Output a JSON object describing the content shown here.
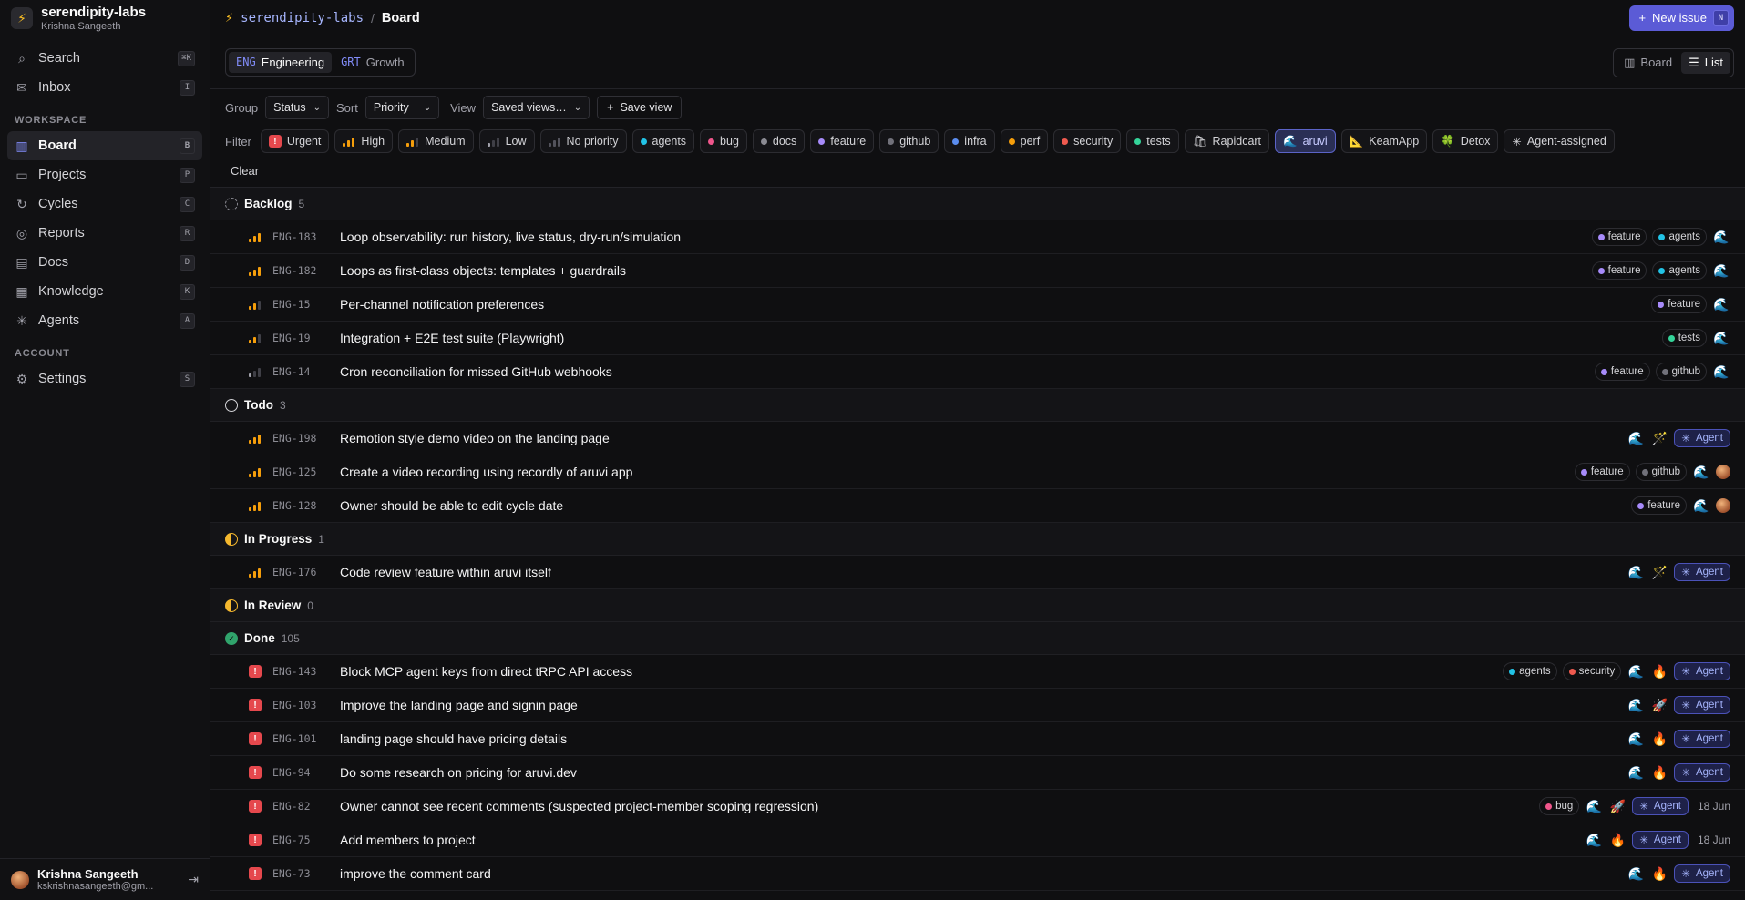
{
  "org": {
    "name": "serendipity-labs",
    "user": "Krishna Sangeeth"
  },
  "nav_top": [
    {
      "label": "Search",
      "key": "⌘K",
      "icon": "⌕"
    },
    {
      "label": "Inbox",
      "key": "I",
      "icon": "✉"
    }
  ],
  "workspace_heading": "WORKSPACE",
  "nav_workspace": [
    {
      "label": "Board",
      "key": "B",
      "icon": "▥",
      "active": true
    },
    {
      "label": "Projects",
      "key": "P",
      "icon": "▭"
    },
    {
      "label": "Cycles",
      "key": "C",
      "icon": "↻"
    },
    {
      "label": "Reports",
      "key": "R",
      "icon": "◎"
    },
    {
      "label": "Docs",
      "key": "D",
      "icon": "▤"
    },
    {
      "label": "Knowledge",
      "key": "K",
      "icon": "▦"
    },
    {
      "label": "Agents",
      "key": "A",
      "icon": "✳"
    }
  ],
  "account_heading": "ACCOUNT",
  "nav_account": [
    {
      "label": "Settings",
      "key": "S",
      "icon": "⚙"
    }
  ],
  "footer": {
    "name": "Krishna Sangeeth",
    "email": "kskrishnasangeeth@gm..."
  },
  "topbar": {
    "org": "serendipity-labs",
    "sep": "/",
    "page": "Board",
    "new_issue": "New issue",
    "new_issue_key": "N"
  },
  "teams": [
    {
      "code": "ENG",
      "name": "Engineering",
      "active": true
    },
    {
      "code": "GRT",
      "name": "Growth",
      "active": false
    }
  ],
  "view_toggle": [
    {
      "label": "Board",
      "active": false
    },
    {
      "label": "List",
      "active": true
    }
  ],
  "controls": {
    "group_label": "Group",
    "group_value": "Status",
    "sort_label": "Sort",
    "sort_value": "Priority",
    "view_label": "View",
    "view_value": "Saved views…",
    "save_view": "Save view"
  },
  "filter": {
    "label": "Filter",
    "chips": [
      {
        "label": "Urgent",
        "kind": "urgent"
      },
      {
        "label": "High",
        "kind": "high"
      },
      {
        "label": "Medium",
        "kind": "medium"
      },
      {
        "label": "Low",
        "kind": "low"
      },
      {
        "label": "No priority",
        "kind": "none"
      },
      {
        "label": "agents",
        "color": "#22c3e6"
      },
      {
        "label": "bug",
        "color": "#f0568c"
      },
      {
        "label": "docs",
        "color": "#8b8b93"
      },
      {
        "label": "feature",
        "color": "#a78bfa"
      },
      {
        "label": "github",
        "color": "#71717a"
      },
      {
        "label": "infra",
        "color": "#5b8def"
      },
      {
        "label": "perf",
        "color": "#f59e0b"
      },
      {
        "label": "security",
        "color": "#ef5a4f"
      },
      {
        "label": "tests",
        "color": "#34d399"
      },
      {
        "label": "Rapidcart",
        "emoji": "🛍"
      },
      {
        "label": "aruvi",
        "emoji": "🌊",
        "selected": true
      },
      {
        "label": "KeamApp",
        "emoji": "📐"
      },
      {
        "label": "Detox",
        "emoji": "🍀"
      },
      {
        "label": "Agent-assigned",
        "emoji": "✳"
      }
    ],
    "clear": "Clear"
  },
  "groups": [
    {
      "name": "Backlog",
      "count": "5",
      "status": "backlog",
      "rows": [
        {
          "id": "ENG-183",
          "title": "Loop observability: run history, live status, dry-run/simulation",
          "pri": "high",
          "tags": [
            "feature",
            "agents"
          ],
          "emojis": [
            "🌊"
          ]
        },
        {
          "id": "ENG-182",
          "title": "Loops as first-class objects: templates + guardrails",
          "pri": "high",
          "tags": [
            "feature",
            "agents"
          ],
          "emojis": [
            "🌊"
          ]
        },
        {
          "id": "ENG-15",
          "title": "Per-channel notification preferences",
          "pri": "medium",
          "tags": [
            "feature"
          ],
          "emojis": [
            "🌊"
          ]
        },
        {
          "id": "ENG-19",
          "title": "Integration + E2E test suite (Playwright)",
          "pri": "medium",
          "tags": [
            "tests"
          ],
          "emojis": [
            "🌊"
          ]
        },
        {
          "id": "ENG-14",
          "title": "Cron reconciliation for missed GitHub webhooks",
          "pri": "low",
          "tags": [
            "feature",
            "github"
          ],
          "emojis": [
            "🌊"
          ]
        }
      ]
    },
    {
      "name": "Todo",
      "count": "3",
      "status": "todo",
      "rows": [
        {
          "id": "ENG-198",
          "title": "Remotion style demo video on the landing page",
          "pri": "high",
          "tags": [],
          "emojis": [
            "🌊",
            "🪄"
          ],
          "agent": "Agent"
        },
        {
          "id": "ENG-125",
          "title": "Create a video recording using recordly of aruvi app",
          "pri": "high",
          "tags": [
            "feature",
            "github"
          ],
          "emojis": [
            "🌊"
          ],
          "avatar": true
        },
        {
          "id": "ENG-128",
          "title": "Owner should be able to edit cycle date",
          "pri": "high",
          "tags": [
            "feature"
          ],
          "emojis": [
            "🌊"
          ],
          "avatar": true
        }
      ]
    },
    {
      "name": "In Progress",
      "count": "1",
      "status": "progress",
      "rows": [
        {
          "id": "ENG-176",
          "title": "Code review feature within aruvi itself",
          "pri": "high",
          "tags": [],
          "emojis": [
            "🌊",
            "🪄"
          ],
          "agent": "Agent"
        }
      ]
    },
    {
      "name": "In Review",
      "count": "0",
      "status": "review",
      "rows": []
    },
    {
      "name": "Done",
      "count": "105",
      "status": "done",
      "rows": [
        {
          "id": "ENG-143",
          "title": "Block MCP agent keys from direct tRPC API access",
          "pri": "urgent",
          "tags": [
            "agents",
            "security"
          ],
          "emojis": [
            "🌊",
            "🔥"
          ],
          "agent": "Agent"
        },
        {
          "id": "ENG-103",
          "title": "Improve the landing page and signin page",
          "pri": "urgent",
          "tags": [],
          "emojis": [
            "🌊",
            "🚀"
          ],
          "agent": "Agent"
        },
        {
          "id": "ENG-101",
          "title": "landing page should have pricing details",
          "pri": "urgent",
          "tags": [],
          "emojis": [
            "🌊",
            "🔥"
          ],
          "agent": "Agent"
        },
        {
          "id": "ENG-94",
          "title": "Do some research on pricing for aruvi.dev",
          "pri": "urgent",
          "tags": [],
          "emojis": [
            "🌊",
            "🔥"
          ],
          "agent": "Agent"
        },
        {
          "id": "ENG-82",
          "title": "Owner cannot see recent comments (suspected project-member scoping regression)",
          "pri": "urgent",
          "tags": [
            "bug"
          ],
          "emojis": [
            "🌊",
            "🚀"
          ],
          "agent": "Agent",
          "date": "18 Jun"
        },
        {
          "id": "ENG-75",
          "title": "Add members to project",
          "pri": "urgent",
          "tags": [],
          "emojis": [
            "🌊",
            "🔥"
          ],
          "agent": "Agent",
          "date": "18 Jun"
        },
        {
          "id": "ENG-73",
          "title": "improve the comment card",
          "pri": "urgent",
          "tags": [],
          "emojis": [
            "🌊",
            "🔥"
          ],
          "agent": "Agent"
        }
      ]
    }
  ],
  "tag_colors": {
    "agents": "#22c3e6",
    "bug": "#f0568c",
    "feature": "#a78bfa",
    "github": "#71717a",
    "security": "#ef5a4f",
    "tests": "#34d399"
  },
  "status_colors": {
    "backlog": "#8b8b93",
    "todo": "#d4d4d8",
    "progress": "#f5b82e",
    "review": "#f5b82e",
    "done": "#30a46c"
  }
}
